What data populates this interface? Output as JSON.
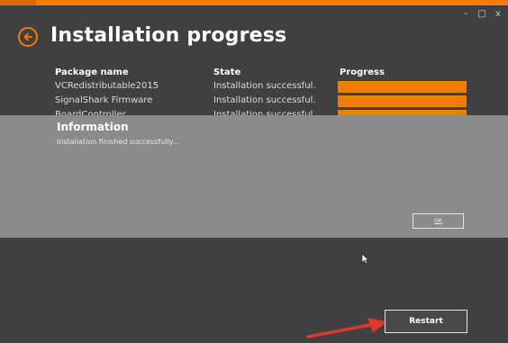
{
  "window": {
    "controls": {
      "minimize": "-",
      "maximize": "□",
      "close": "x"
    }
  },
  "header": {
    "title": "Installation progress",
    "back_icon": "arrow-left-circle-icon",
    "accent_color": "#f07c00"
  },
  "table": {
    "columns": [
      "Package name",
      "State",
      "Progress"
    ],
    "rows": [
      {
        "name": "VCRedistributable2015",
        "state": "Installation successful.",
        "progress": 1.0
      },
      {
        "name": "SignalShark Firmware",
        "state": "Installation successful.",
        "progress": 1.0
      },
      {
        "name": "BoardController",
        "state": "Installation successful.",
        "progress": 1.0
      }
    ]
  },
  "dialog": {
    "title": "Information",
    "message": "Installation finished successfully...",
    "ok_label": "OK"
  },
  "footer": {
    "restart_label": "Restart"
  },
  "colors": {
    "background": "#404040",
    "overlay": "#8b8b8b",
    "progress": "#f07c00",
    "annotation_arrow": "#d9382c"
  }
}
